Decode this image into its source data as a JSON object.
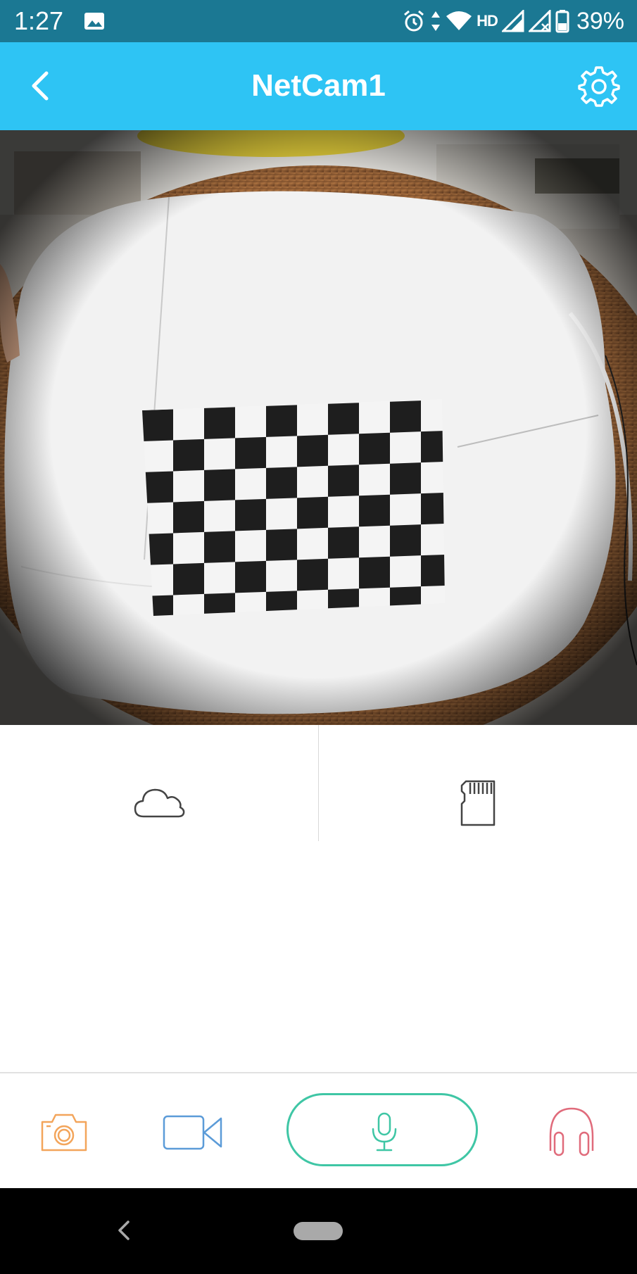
{
  "status_bar": {
    "time": "1:27",
    "network_label": "HD",
    "battery": "39%",
    "icons": [
      "image-icon",
      "alarm-icon",
      "data-arrows-icon",
      "wifi-icon",
      "signal-icon",
      "signal-no-sim-icon",
      "battery-icon"
    ]
  },
  "header": {
    "title": "NetCam1",
    "back_icon": "chevron-left-icon",
    "settings_icon": "gear-icon",
    "background_color": "#2ec4f4"
  },
  "video": {
    "description_icon": "live-camera-feed"
  },
  "storage": {
    "cloud_icon": "cloud-icon",
    "sd_card_icon": "sd-card-icon"
  },
  "toolbar": {
    "snapshot_icon": "camera-icon",
    "snapshot_color": "#f3a55b",
    "record_icon": "video-camera-icon",
    "record_color": "#5b9bd8",
    "talk_icon": "microphone-icon",
    "talk_color": "#3fc6a5",
    "listen_icon": "headphones-icon",
    "listen_color": "#e06b7b"
  },
  "nav_bar": {
    "back_icon": "nav-back-icon",
    "home_icon": "nav-home-pill"
  }
}
